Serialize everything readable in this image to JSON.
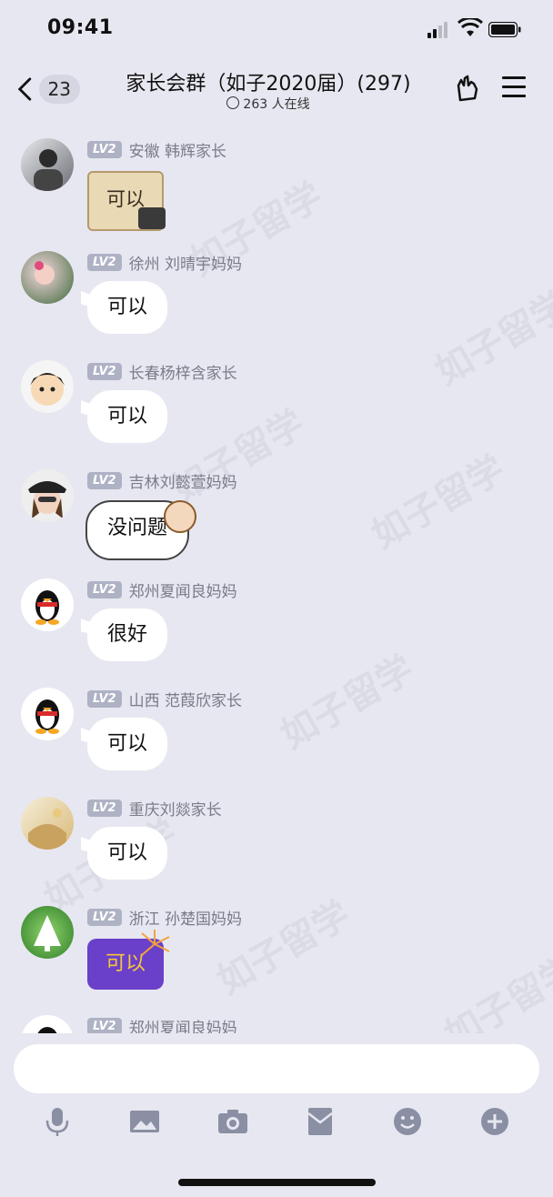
{
  "status_bar": {
    "time": "09:41"
  },
  "header": {
    "unread_count": "23",
    "title": "家长会群（如子2020届）(297)",
    "online_text": "263 人在线"
  },
  "messages": [
    {
      "level": "LV2",
      "sender": "安徽 韩辉家长",
      "content": "可以",
      "type": "sticker-scroll"
    },
    {
      "level": "LV2",
      "sender": "徐州 刘晴宇妈妈",
      "content": "可以",
      "type": "text"
    },
    {
      "level": "LV2",
      "sender": "长春杨梓含家长",
      "content": "可以",
      "type": "text"
    },
    {
      "level": "LV2",
      "sender": "吉林刘懿萱妈妈",
      "content": "没问题",
      "type": "sticker-sheep"
    },
    {
      "level": "LV2",
      "sender": "郑州夏闻良妈妈",
      "content": "很好",
      "type": "text"
    },
    {
      "level": "LV2",
      "sender": "山西 范葭欣家长",
      "content": "可以",
      "type": "text"
    },
    {
      "level": "LV2",
      "sender": "重庆刘燚家长",
      "content": "可以",
      "type": "text"
    },
    {
      "level": "LV2",
      "sender": "浙江 孙楚国妈妈",
      "content": "可以",
      "type": "sticker-fireworks"
    },
    {
      "level": "LV2",
      "sender": "郑州夏闻良妈妈",
      "content": "",
      "type": "partial"
    }
  ],
  "watermark": {
    "text": "如子留学"
  },
  "toolbar": {
    "icons": [
      "microphone-icon",
      "image-icon",
      "camera-icon",
      "red-packet-icon",
      "emoji-icon",
      "plus-icon"
    ]
  },
  "colors": {
    "background": "#e7e7f1",
    "level_badge": "#aeb2c4",
    "sender_text": "#7b7b87"
  }
}
